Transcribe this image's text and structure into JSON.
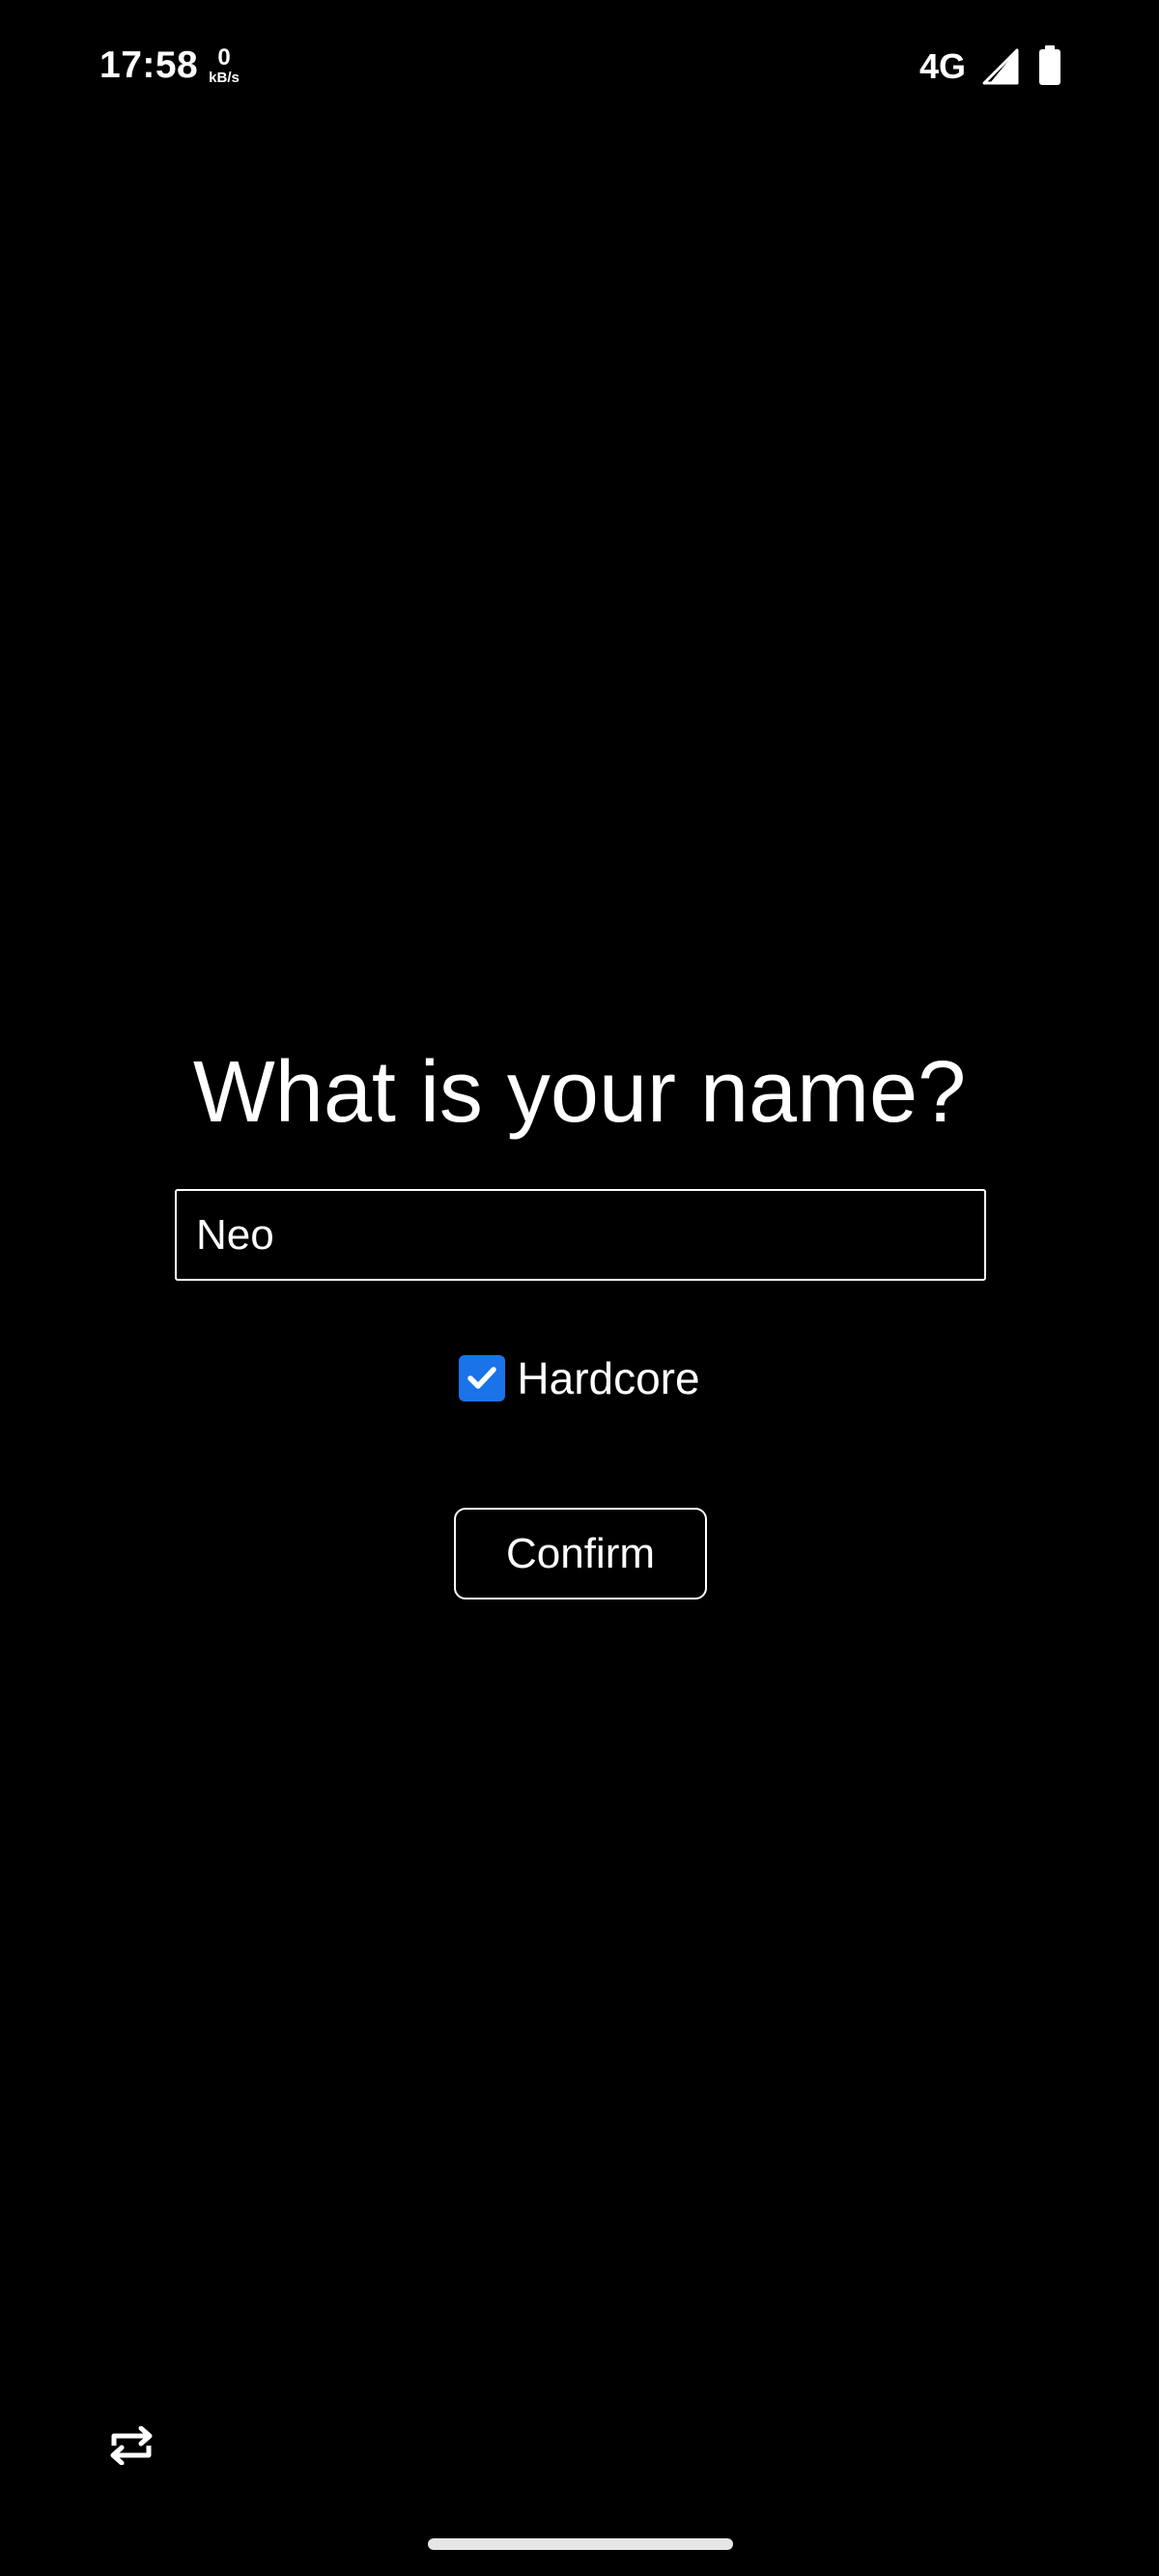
{
  "status_bar": {
    "time": "17:58",
    "net_speed_value": "0",
    "net_speed_unit": "kB/s",
    "network_type": "4G",
    "signal_icon": "cellular-signal-icon",
    "battery_icon": "battery-icon"
  },
  "form": {
    "title": "What is your name?",
    "name_input": {
      "value": "Neo",
      "placeholder": ""
    },
    "hardcore": {
      "label": "Hardcore",
      "checked": true
    },
    "confirm_label": "Confirm"
  },
  "bottom": {
    "rotate_icon": "screen-rotate-icon"
  },
  "colors": {
    "background": "#000000",
    "foreground": "#ffffff",
    "checkbox_accent": "#1a73e8"
  }
}
